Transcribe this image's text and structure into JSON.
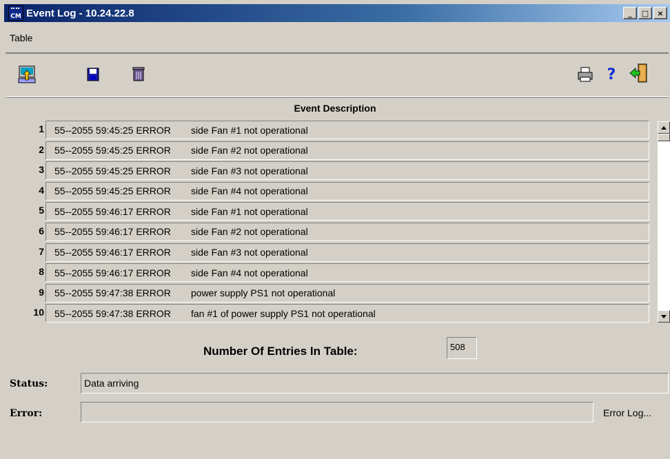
{
  "window": {
    "title": "Event Log - 10.24.22.8",
    "app_icon_text": "CM",
    "controls": {
      "minimize": "_",
      "maximize": "□",
      "close": "×"
    }
  },
  "menu": {
    "items": [
      {
        "label": "Table"
      }
    ]
  },
  "toolbar": {
    "icons": [
      "upload-icon",
      "save-icon",
      "delete-icon",
      "print-icon",
      "help-icon",
      "exit-icon"
    ],
    "help_glyph": "?"
  },
  "table": {
    "header": "Event Description",
    "rows": [
      {
        "num": "1",
        "timestamp": "55--2055 59:45:25 ERROR",
        "desc": "side Fan #1 not operational"
      },
      {
        "num": "2",
        "timestamp": "55--2055 59:45:25 ERROR",
        "desc": "side Fan #2 not operational"
      },
      {
        "num": "3",
        "timestamp": "55--2055 59:45:25 ERROR",
        "desc": "side Fan #3 not operational"
      },
      {
        "num": "4",
        "timestamp": "55--2055 59:45:25 ERROR",
        "desc": "side Fan #4 not operational"
      },
      {
        "num": "5",
        "timestamp": "55--2055 59:46:17 ERROR",
        "desc": "side Fan #1 not operational"
      },
      {
        "num": "6",
        "timestamp": "55--2055 59:46:17 ERROR",
        "desc": "side Fan #2 not operational"
      },
      {
        "num": "7",
        "timestamp": "55--2055 59:46:17 ERROR",
        "desc": "side Fan #3 not operational"
      },
      {
        "num": "8",
        "timestamp": "55--2055 59:46:17 ERROR",
        "desc": "side Fan #4 not operational"
      },
      {
        "num": "9",
        "timestamp": "55--2055 59:47:38 ERROR",
        "desc": "power supply PS1 not operational"
      },
      {
        "num": "10",
        "timestamp": "55--2055 59:47:38 ERROR",
        "desc": "fan #1 of power supply PS1 not operational"
      }
    ]
  },
  "count": {
    "label": "Number Of Entries In Table:",
    "value": "508"
  },
  "status": {
    "label": "Status:",
    "value": "Data arriving"
  },
  "error": {
    "label": "Error:",
    "value": "",
    "log_button": "Error Log..."
  }
}
